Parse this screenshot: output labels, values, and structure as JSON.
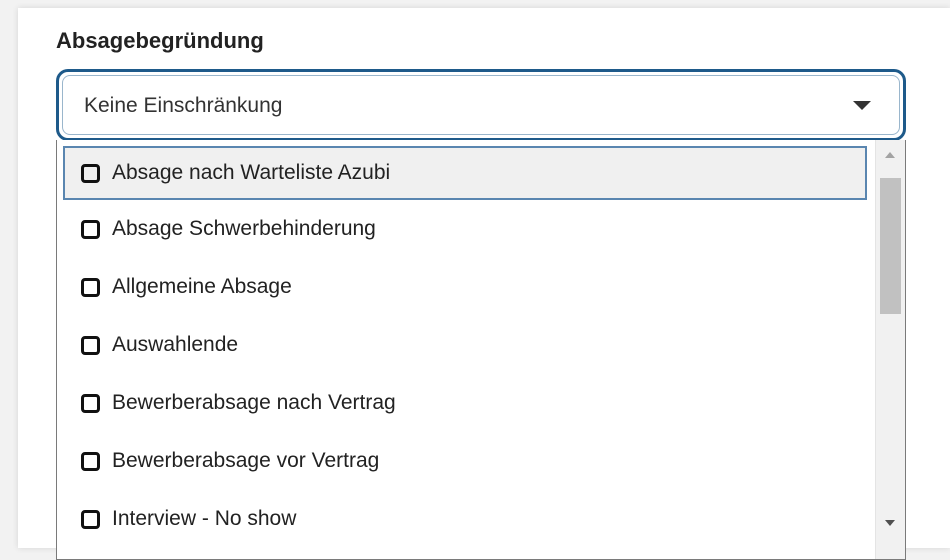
{
  "field": {
    "label": "Absagebegründung",
    "selected_value": "Keine Einschränkung"
  },
  "dropdown": {
    "options": [
      {
        "label": "Absage nach Warteliste Azubi",
        "checked": false,
        "highlighted": true
      },
      {
        "label": "Absage Schwerbehinderung",
        "checked": false
      },
      {
        "label": "Allgemeine Absage",
        "checked": false
      },
      {
        "label": "Auswahlende",
        "checked": false
      },
      {
        "label": "Bewerberabsage nach Vertrag",
        "checked": false
      },
      {
        "label": "Bewerberabsage vor Vertrag",
        "checked": false
      },
      {
        "label": "Interview - No show",
        "checked": false
      }
    ]
  },
  "colors": {
    "focus_border": "#1e5a8a",
    "highlight_border": "#5a86b0",
    "highlight_bg": "#f0f0f0"
  },
  "icons": {
    "caret": "caret-down-icon",
    "checkbox": "checkbox-unchecked-icon"
  }
}
